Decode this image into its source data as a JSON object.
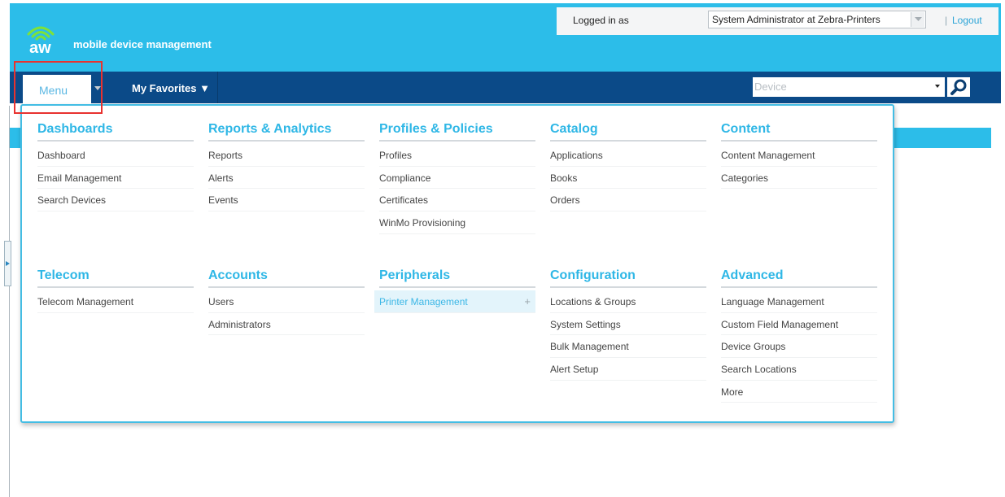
{
  "brand": {
    "logo_text": "aw",
    "tagline": "mobile device management",
    "color": "#2cbde9"
  },
  "login": {
    "label": "Logged in as",
    "user": "System Administrator at Zebra-Printers",
    "separator": "|",
    "logout": "Logout"
  },
  "nav": {
    "menu_label": "Menu",
    "favorites_label": "My Favorites ▼",
    "device_placeholder": "Device",
    "color": "#0b4a88"
  },
  "menu": {
    "columns_top": [
      {
        "title": "Dashboards",
        "items": [
          "Dashboard",
          "Email Management",
          "Search Devices"
        ]
      },
      {
        "title": "Reports & Analytics",
        "items": [
          "Reports",
          "Alerts",
          "Events"
        ]
      },
      {
        "title": "Profiles & Policies",
        "items": [
          "Profiles",
          "Compliance",
          "Certificates",
          "WinMo Provisioning"
        ]
      },
      {
        "title": "Catalog",
        "items": [
          "Applications",
          "Books",
          "Orders"
        ]
      },
      {
        "title": "Content",
        "items": [
          "Content Management",
          "Categories"
        ]
      }
    ],
    "columns_bottom": [
      {
        "title": "Telecom",
        "items": [
          "Telecom Management"
        ]
      },
      {
        "title": "Accounts",
        "items": [
          "Users",
          "Administrators"
        ]
      },
      {
        "title": "Peripherals",
        "items": [
          "Printer Management"
        ],
        "active_item": "Printer Management",
        "active_suffix": "+"
      },
      {
        "title": "Configuration",
        "items": [
          "Locations & Groups",
          "System Settings",
          "Bulk Management",
          "Alert Setup"
        ]
      },
      {
        "title": "Advanced",
        "items": [
          "Language Management",
          "Custom Field Management",
          "Device Groups",
          "Search Locations",
          "More"
        ]
      }
    ],
    "title_color": "#2fb7e6",
    "active_color": "#3cb7e6"
  },
  "icons": {
    "logo": "wifi-waves-icon",
    "user_dropdown": "chevron-down-icon",
    "device_dropdown": "caret-down-icon",
    "search": "search-icon",
    "panel_toggle": "caret-right-icon"
  }
}
